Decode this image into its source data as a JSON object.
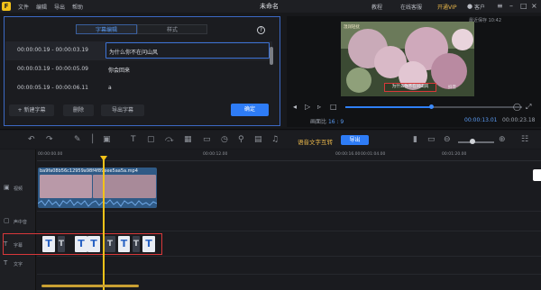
{
  "app": {
    "logo_text": "F",
    "menu": [
      "文件",
      "编辑",
      "导出",
      "帮助"
    ],
    "title": "未命名",
    "right_menu": [
      "教程",
      "在线客服",
      "开通VIP"
    ],
    "user_label": "客户"
  },
  "subtitle_panel": {
    "tabs": [
      "字幕编辑",
      "样式"
    ],
    "help_icon": "?",
    "rows": [
      {
        "time": "00:00:00.19 - 00:00:03.19",
        "text": "为什么你不在问山风"
      },
      {
        "time": "00:00:03.19 - 00:00:05.09",
        "text": "你会回来"
      },
      {
        "time": "00:00:05.19 - 00:00:06.11",
        "text": "a"
      }
    ],
    "buttons": {
      "new": "+ 新建字幕",
      "delete": "删除",
      "export": "导出字幕",
      "ok": "确定"
    }
  },
  "preview": {
    "label": "最近保存 10:42",
    "watermark": "湿润轻抚",
    "tiktok_tag": "抖音",
    "video_subtitle": "为什么你不在问山风",
    "ratio_label": "画面比",
    "ratio_value": "16 : 9",
    "current_time": "00:00:13.01",
    "total_time": "00:00:23.18",
    "progress_fraction": 0.48
  },
  "toolbar": {
    "ai_label": "语音文字互转",
    "export_label": "导出"
  },
  "timeline": {
    "ticks": [
      "00:00:00.00",
      "00:00:12.00",
      "00:00:16.00",
      "00:01:04.00",
      "00:01:20.00"
    ],
    "tracks": [
      {
        "label": "视频"
      },
      {
        "label": "声中音"
      },
      {
        "label": "字幕"
      },
      {
        "label": "文字"
      }
    ],
    "clip_name": "ba9fa08b56c12959a98f4f89eee5aa5a.mp4"
  }
}
